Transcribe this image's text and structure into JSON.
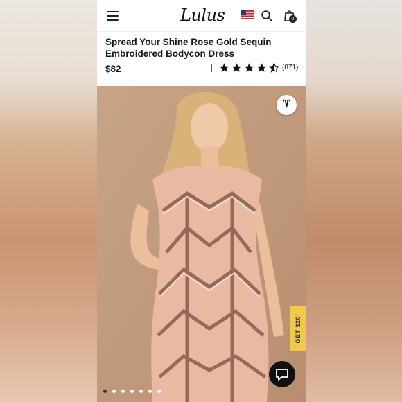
{
  "header": {
    "logo_text": "Lulus",
    "cart_count": "0",
    "icons": [
      "menu-icon",
      "us-flag-icon",
      "search-icon",
      "shopping-bag-icon"
    ]
  },
  "product": {
    "title": "Spread Your Shine Rose Gold Sequin Embroidered Bodycon Dress",
    "price": "$82",
    "rating": 4.5,
    "review_count": "(871)"
  },
  "gallery": {
    "promo_label": "GET $20!",
    "dot_count": 7,
    "active_dot": 0
  },
  "colors": {
    "promo": "#f2c94c",
    "chat": "#111111",
    "photo_bg": "#c59f81",
    "dress": "#e9b9a2",
    "sequin": "#8a5a4e"
  }
}
